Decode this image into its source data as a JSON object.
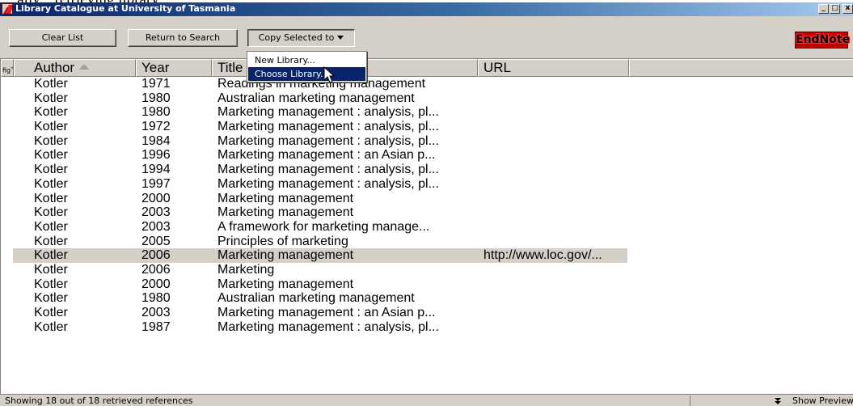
{
  "window": {
    "title": "Library Catalogue at University of Tasmania",
    "top_cut_text": "...ally... retrieving library",
    "minimize": "_",
    "maximize": "□",
    "close": "x"
  },
  "toolbar": {
    "clear_list": "Clear List",
    "return_to_search": "Return to Search",
    "copy_selected_to": "Copy Selected to",
    "logo_text": "EndNote"
  },
  "menu": {
    "items": [
      {
        "label": "New Library..."
      },
      {
        "label": "Choose Library..."
      }
    ]
  },
  "columns": {
    "fig": "fig",
    "author": "Author",
    "year": "Year",
    "title": "Title",
    "url": "URL"
  },
  "rows": [
    {
      "author": "Kotler",
      "year": "1971",
      "title": "Readings in marketing management",
      "url": "",
      "selected": false
    },
    {
      "author": "Kotler",
      "year": "1980",
      "title": "Australian marketing management",
      "url": "",
      "selected": false
    },
    {
      "author": "Kotler",
      "year": "1980",
      "title": "Marketing management : analysis, pl...",
      "url": "",
      "selected": false
    },
    {
      "author": "Kotler",
      "year": "1972",
      "title": "Marketing management : analysis, pl...",
      "url": "",
      "selected": false
    },
    {
      "author": "Kotler",
      "year": "1984",
      "title": "Marketing management : analysis, pl...",
      "url": "",
      "selected": false
    },
    {
      "author": "Kotler",
      "year": "1996",
      "title": "Marketing management : an Asian p...",
      "url": "",
      "selected": false
    },
    {
      "author": "Kotler",
      "year": "1994",
      "title": "Marketing management : analysis, pl...",
      "url": "",
      "selected": false
    },
    {
      "author": "Kotler",
      "year": "1997",
      "title": "Marketing management : analysis, pl...",
      "url": "",
      "selected": false
    },
    {
      "author": "Kotler",
      "year": "2000",
      "title": "Marketing management",
      "url": "",
      "selected": false
    },
    {
      "author": "Kotler",
      "year": "2003",
      "title": "Marketing management",
      "url": "",
      "selected": false
    },
    {
      "author": "Kotler",
      "year": "2003",
      "title": "A framework for marketing manage...",
      "url": "",
      "selected": false
    },
    {
      "author": "Kotler",
      "year": "2005",
      "title": "Principles of marketing",
      "url": "",
      "selected": false
    },
    {
      "author": "Kotler",
      "year": "2006",
      "title": "Marketing management",
      "url": "http://www.loc.gov/...",
      "selected": true
    },
    {
      "author": "Kotler",
      "year": "2006",
      "title": "Marketing",
      "url": "",
      "selected": false
    },
    {
      "author": "Kotler",
      "year": "2000",
      "title": "Marketing management",
      "url": "",
      "selected": false
    },
    {
      "author": "Kotler",
      "year": "1980",
      "title": "Australian marketing management",
      "url": "",
      "selected": false
    },
    {
      "author": "Kotler",
      "year": "2003",
      "title": "Marketing management : an Asian p...",
      "url": "",
      "selected": false
    },
    {
      "author": "Kotler",
      "year": "1987",
      "title": "Marketing management : analysis, pl...",
      "url": "",
      "selected": false
    }
  ],
  "status": {
    "text": "Showing 18 out of 18 retrieved references",
    "show_preview": "Show Preview"
  },
  "colors": {
    "titlebar_start": "#0a246a",
    "titlebar_end": "#a6caf0",
    "menu_highlight": "#0a246a",
    "selected_row": "#d4d0c8",
    "logo": "#c00000"
  },
  "icons": {
    "app": "endnote-app-icon",
    "sort": "sort-ascending-icon",
    "dropdown": "dropdown-caret-icon",
    "preview": "show-preview-chevrons-icon",
    "cursor": "mouse-pointer-icon"
  }
}
